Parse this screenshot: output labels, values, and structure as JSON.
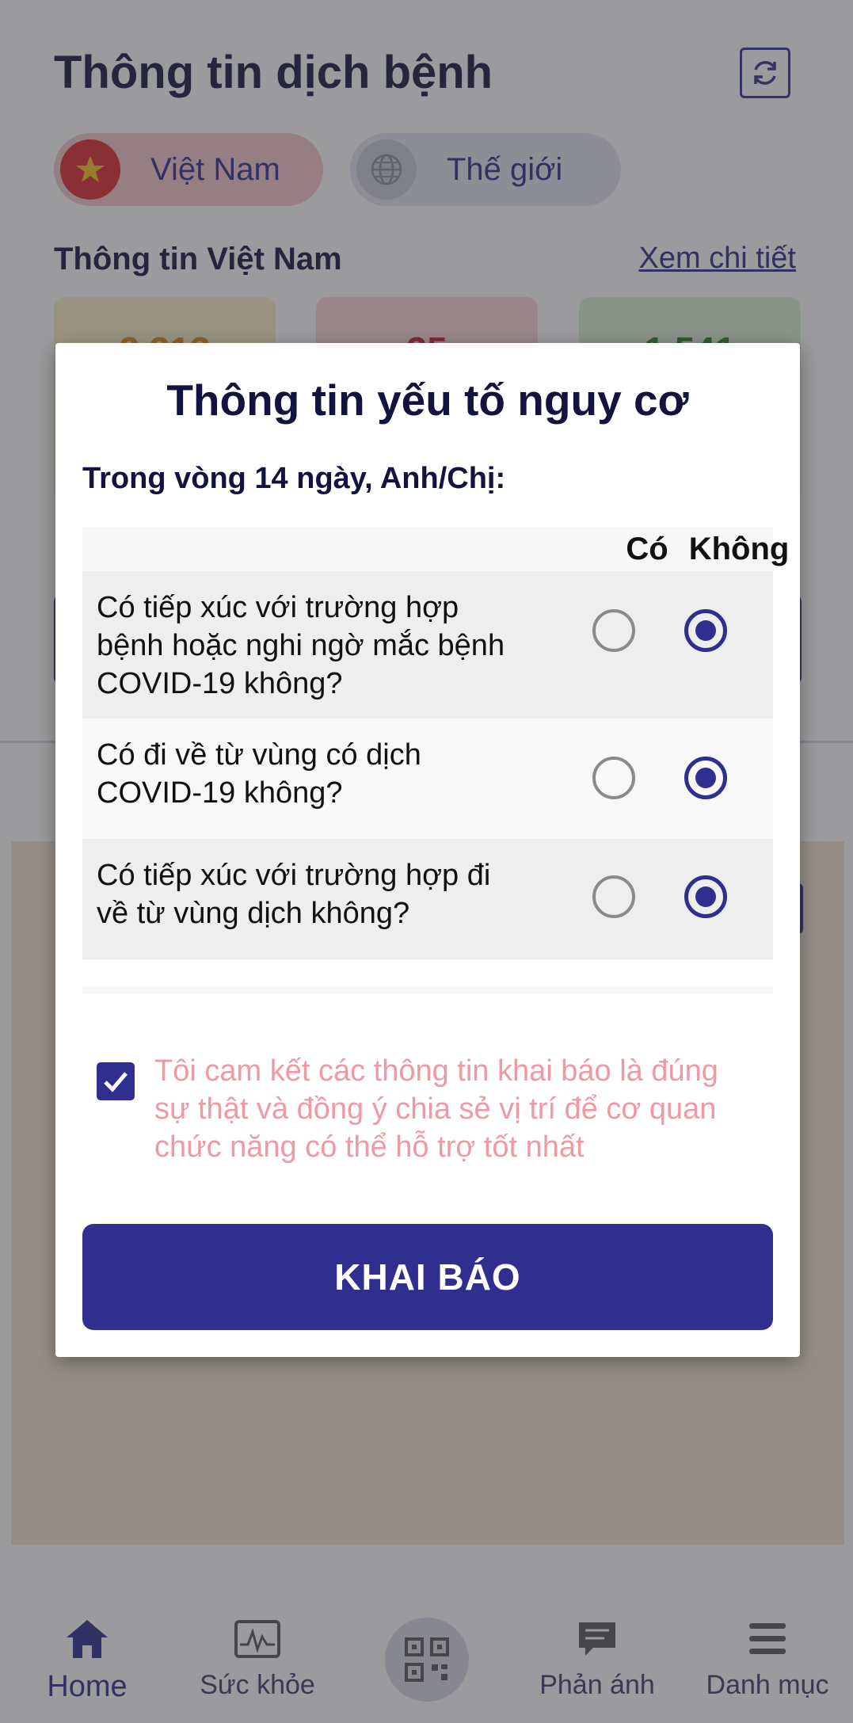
{
  "header": {
    "title": "Thông tin dịch bệnh"
  },
  "region_tabs": {
    "vietnam_label": "Việt Nam",
    "world_label": "Thế giới"
  },
  "section": {
    "title": "Thông tin Việt Nam",
    "detail_link": "Xem chi tiết"
  },
  "stats": {
    "card1": "2.313",
    "card2": "35",
    "card3": "1.541"
  },
  "modal": {
    "title": "Thông tin yếu tố nguy cơ",
    "subtitle": "Trong vòng 14 ngày, Anh/Chị:",
    "col_yes": "Có",
    "col_no": "Không",
    "questions": [
      {
        "line1": "Có tiếp xúc với trường hợp",
        "line2": "bệnh hoặc nghi ngờ mắc bệnh",
        "line3": "COVID-19 không?",
        "answer": "Không"
      },
      {
        "line1": "Có đi về từ vùng có dịch",
        "line2": "COVID-19 không?",
        "answer": "Không"
      },
      {
        "line1": "Có tiếp xúc với trường hợp đi",
        "line2": "về từ vùng dịch không?",
        "answer": "Không"
      }
    ],
    "commitment": {
      "checked": true,
      "line1": "Tôi cam kết các thông tin khai báo là đúng",
      "line2": "sự thật và đồng ý chia sẻ vị trí để cơ quan",
      "line3": "chức năng có thể hỗ trợ tốt nhất"
    },
    "submit_label": "KHAI BÁO"
  },
  "bottom_nav": {
    "home": "Home",
    "health": "Sức khỏe",
    "feedback": "Phản ánh",
    "menu": "Danh mục"
  },
  "colors": {
    "primary": "#2f2f8f",
    "danger": "#d9282f",
    "commit_text": "#ef9aa2"
  }
}
